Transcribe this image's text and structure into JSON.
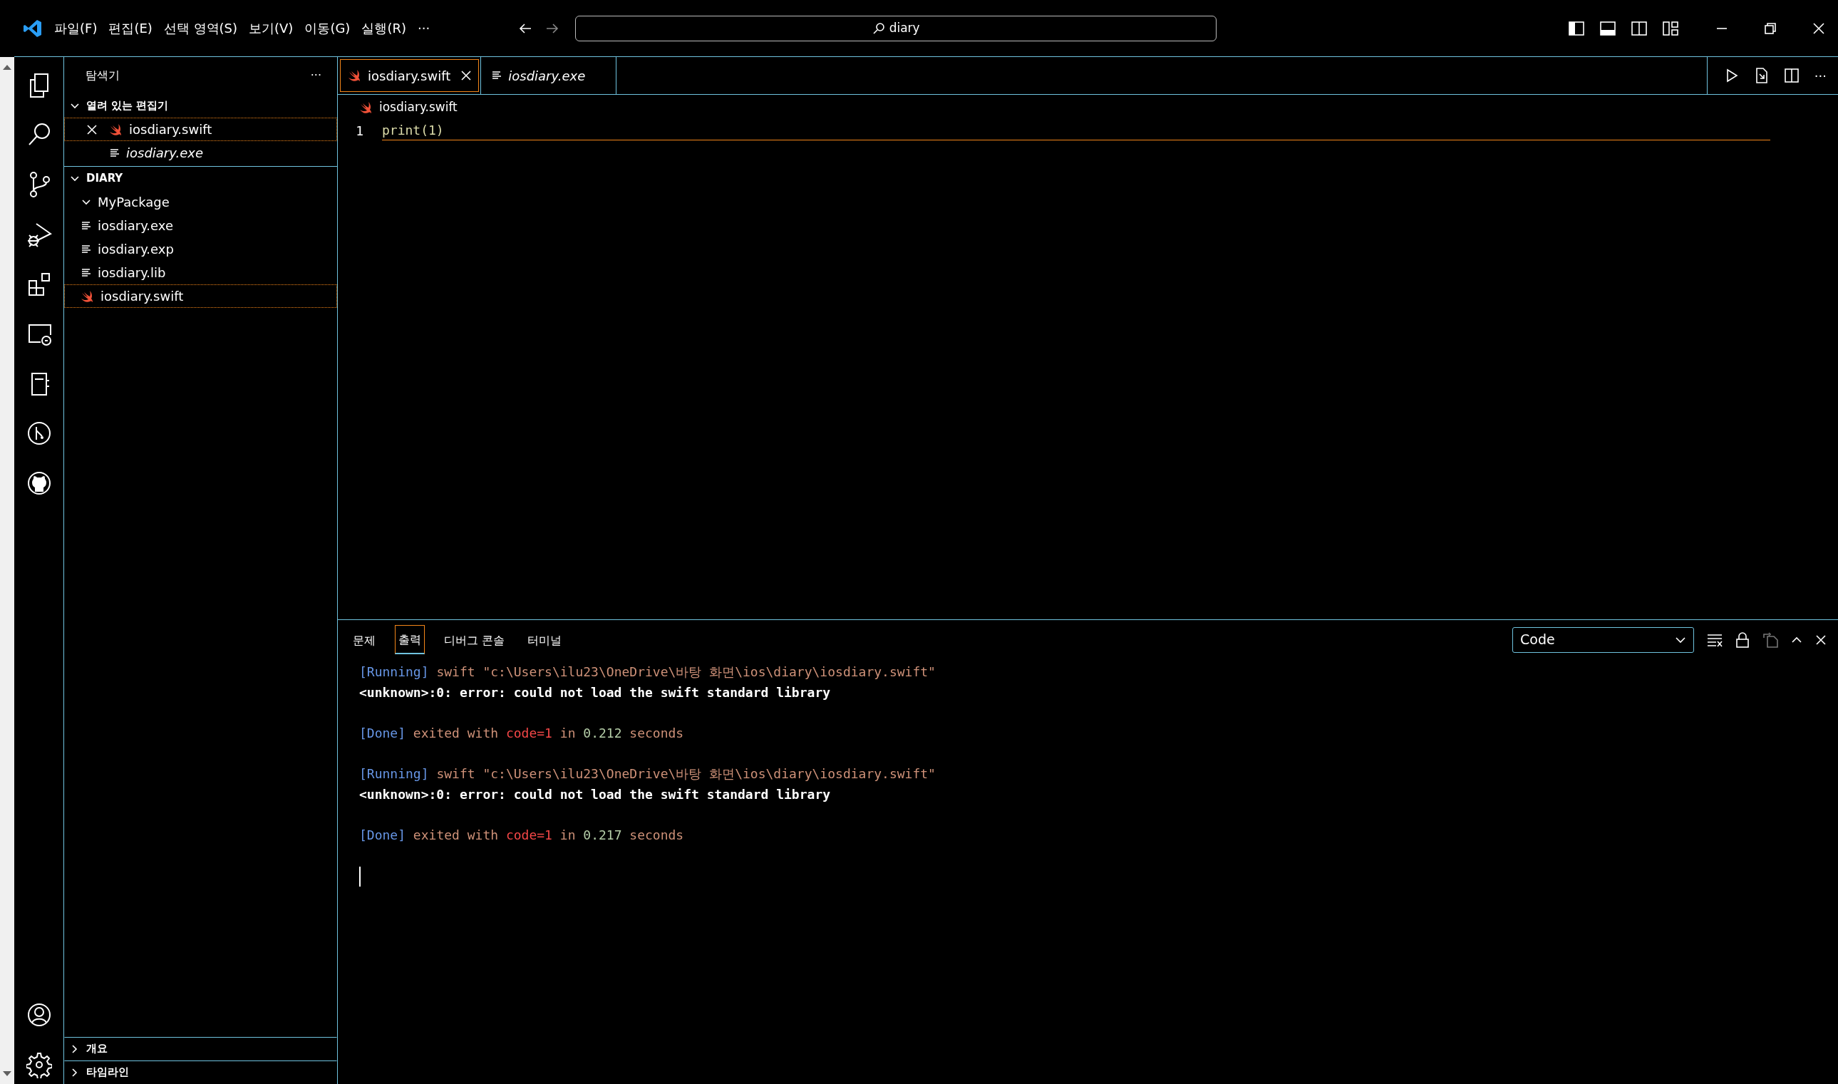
{
  "title_bar": {
    "menu": [
      "파일(F)",
      "편집(E)",
      "선택 영역(S)",
      "보기(V)",
      "이동(G)",
      "실행(R)"
    ],
    "more": "···",
    "search": "diary"
  },
  "sidebar": {
    "title": "탐색기",
    "more": "···",
    "open_editors": {
      "title": "열려 있는 편집기",
      "expanded": true,
      "items": [
        {
          "name": "iosdiary.swift",
          "kind": "swift",
          "preview": false,
          "focused": true
        },
        {
          "name": "iosdiary.exe",
          "kind": "file",
          "preview": true,
          "focused": false
        }
      ]
    },
    "folder": {
      "title": "DIARY",
      "expanded": true,
      "children": [
        {
          "name": "MyPackage",
          "kind": "folder",
          "expanded": true,
          "focused": false
        },
        {
          "name": "iosdiary.exe",
          "kind": "file",
          "focused": false
        },
        {
          "name": "iosdiary.exp",
          "kind": "file",
          "focused": false
        },
        {
          "name": "iosdiary.lib",
          "kind": "file",
          "focused": false
        },
        {
          "name": "iosdiary.swift",
          "kind": "swift",
          "focused": true
        }
      ]
    },
    "sections": [
      {
        "title": "개요",
        "expanded": false
      },
      {
        "title": "타임라인",
        "expanded": false
      }
    ]
  },
  "editor": {
    "tabs": [
      {
        "label": "iosdiary.swift",
        "kind": "swift",
        "selected": true,
        "preview": false
      },
      {
        "label": "iosdiary.exe",
        "kind": "file",
        "selected": false,
        "preview": true
      }
    ],
    "more": "···",
    "breadcrumb": "iosdiary.swift",
    "lines": [
      {
        "number": "1",
        "code": "print(1)",
        "current": true
      }
    ]
  },
  "panel": {
    "tabs": [
      {
        "label": "문제",
        "selected": false
      },
      {
        "label": "출력",
        "selected": true
      },
      {
        "label": "디버그 콘솔",
        "selected": false
      },
      {
        "label": "터미널",
        "selected": false
      }
    ],
    "channel": "Code",
    "output": [
      {
        "lines": [
          [
            {
              "kind": "tag",
              "text": "[Running]"
            },
            {
              "kind": "path",
              "text": " swift \"c:\\Users\\ilu23\\OneDrive\\바탕 화면\\ios\\diary\\iosdiary.swift\""
            }
          ],
          [
            {
              "kind": "plain",
              "text": "<unknown>:0: error: could not load the swift standard library"
            }
          ]
        ]
      },
      {
        "lines": [
          [
            {
              "kind": "tag",
              "text": "[Done]"
            },
            {
              "kind": "path",
              "text": " exited with "
            },
            {
              "kind": "error",
              "text": "code=1"
            },
            {
              "kind": "path",
              "text": " in "
            },
            {
              "kind": "number",
              "text": "0.212"
            },
            {
              "kind": "path",
              "text": " seconds"
            }
          ]
        ]
      },
      {
        "lines": [
          [
            {
              "kind": "tag",
              "text": "[Running]"
            },
            {
              "kind": "path",
              "text": " swift \"c:\\Users\\ilu23\\OneDrive\\바탕 화면\\ios\\diary\\iosdiary.swift\""
            }
          ],
          [
            {
              "kind": "plain",
              "text": "<unknown>:0: error: could not load the swift standard library"
            }
          ]
        ]
      },
      {
        "lines": [
          [
            {
              "kind": "tag",
              "text": "[Done]"
            },
            {
              "kind": "path",
              "text": " exited with "
            },
            {
              "kind": "error",
              "text": "code=1"
            },
            {
              "kind": "path",
              "text": " in "
            },
            {
              "kind": "number",
              "text": "0.217"
            },
            {
              "kind": "path",
              "text": " seconds"
            }
          ]
        ]
      }
    ],
    "cursor": true
  }
}
